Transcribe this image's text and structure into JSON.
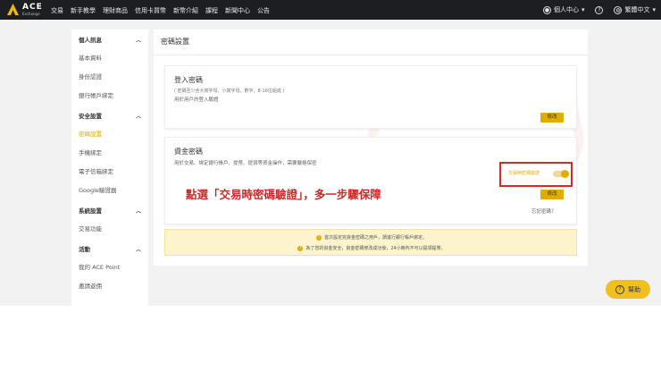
{
  "brand": {
    "name": "ACE",
    "sub": "Exchange"
  },
  "nav": [
    "交易",
    "新手教學",
    "理財商品",
    "信用卡買幣",
    "新幣介紹",
    "課程",
    "新聞中心",
    "公告"
  ],
  "header_right": {
    "account": "個人中心",
    "help_icon": "?",
    "language": "繁體中文"
  },
  "sidebar": {
    "groups": [
      {
        "title": "個人訊息",
        "items": [
          "基本資料",
          "身份認證",
          "銀行帳戶綁定"
        ]
      },
      {
        "title": "安全設置",
        "items": [
          "密碼設置",
          "手機綁定",
          "電子信箱綁定",
          "Google驗證器"
        ]
      },
      {
        "title": "系統設置",
        "items": [
          "交易功能"
        ]
      },
      {
        "title": "活動",
        "items": [
          "我的 ACE Point",
          "邀請返佣"
        ]
      }
    ],
    "active_item": "密碼設置"
  },
  "page": {
    "title": "密碼設置",
    "login_card": {
      "title": "登入密碼",
      "requirement": "( 密碼至少含大寫字母，小寫字母，數字，8-16位組成 )",
      "description": "用於用戶的登入驗證",
      "button": "修改"
    },
    "fund_card": {
      "title": "資金密碼",
      "description": "用於交易、綁定銀行帳戶、提幣、提領等資金操作，需要嚴格保密",
      "toggle_label": "交易時密碼驗證",
      "toggle_on": true,
      "callout": "點選「交易時密碼驗證」，多一步驟保障",
      "button": "修改",
      "forgot": "忘記密碼？"
    },
    "notices": [
      "首次設定完資金密碼之用戶，請進行銀行帳戶綁定。",
      "為了您的資金安全，資金密碼修改成功後，24小時內不可以提領提幣。"
    ]
  },
  "help_button": "幫助",
  "colors": {
    "accent": "#e0ac00",
    "callout": "#d02828",
    "topbar": "#1d1e22"
  }
}
